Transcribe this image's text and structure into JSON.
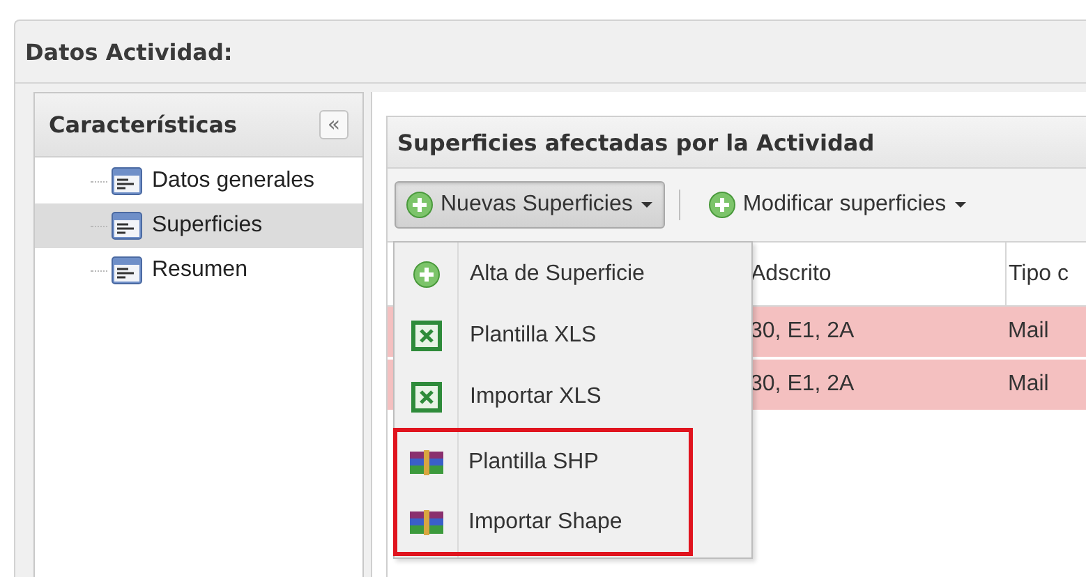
{
  "window": {
    "title": "Datos Actividad:"
  },
  "sidebar": {
    "title": "Características",
    "collapse_button": "«",
    "items": [
      {
        "label": "Datos generales",
        "selected": false
      },
      {
        "label": "Superficies",
        "selected": true
      },
      {
        "label": "Resumen",
        "selected": false
      }
    ]
  },
  "panel": {
    "title": "Superficies afectadas por la Actividad",
    "toolbar": [
      {
        "label": "Nuevas Superficies",
        "pressed": true
      },
      {
        "label": "Modificar superficies",
        "pressed": false
      }
    ],
    "table": {
      "columns": [
        "Adscrito",
        "Tipo c"
      ],
      "rows": [
        [
          "30, E1, 2A",
          "Mail"
        ],
        [
          "30, E1, 2A",
          "Mail"
        ]
      ]
    }
  },
  "menu": {
    "items": [
      {
        "label": "Alta de Superficie",
        "kind": "add",
        "highlighted": false
      },
      {
        "label": "Plantilla XLS",
        "kind": "xls",
        "highlighted": false
      },
      {
        "label": "Importar XLS",
        "kind": "xls",
        "highlighted": false
      },
      {
        "label": "Plantilla SHP",
        "kind": "archive",
        "highlighted": true
      },
      {
        "label": "Importar Shape",
        "kind": "archive",
        "highlighted": true
      }
    ]
  }
}
